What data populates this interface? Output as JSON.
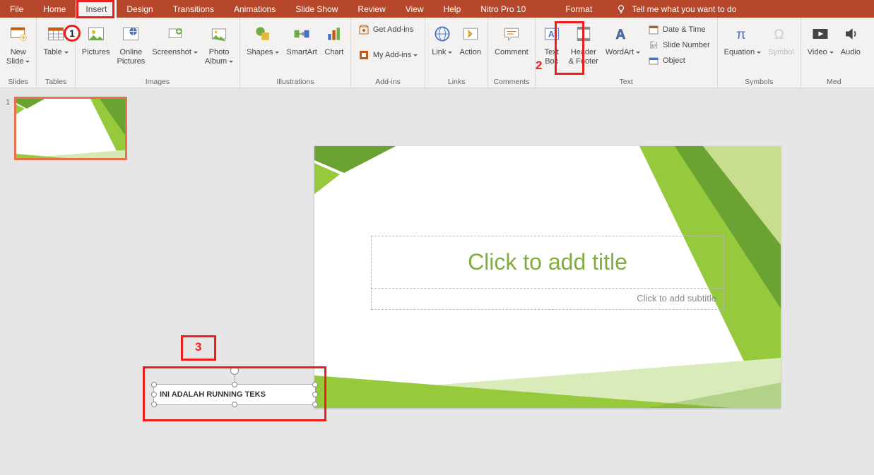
{
  "menu": {
    "tabs": [
      "File",
      "Home",
      "Insert",
      "Design",
      "Transitions",
      "Animations",
      "Slide Show",
      "Review",
      "View",
      "Help",
      "Nitro Pro 10",
      "Format"
    ],
    "active_index": 2,
    "tellme": "Tell me what you want to do"
  },
  "ribbon": {
    "groups": {
      "slides": {
        "label": "Slides",
        "new_slide": "New\nSlide"
      },
      "tables": {
        "label": "Tables",
        "table": "Table"
      },
      "images": {
        "label": "Images",
        "pictures": "Pictures",
        "online_pictures": "Online\nPictures",
        "screenshot": "Screenshot",
        "photo_album": "Photo\nAlbum"
      },
      "illustrations": {
        "label": "Illustrations",
        "shapes": "Shapes",
        "smartart": "SmartArt",
        "chart": "Chart"
      },
      "addins": {
        "label": "Add-ins",
        "get": "Get Add-ins",
        "my": "My Add-ins"
      },
      "links": {
        "label": "Links",
        "link": "Link",
        "action": "Action"
      },
      "comments": {
        "label": "Comments",
        "comment": "Comment"
      },
      "text": {
        "label": "Text",
        "text_box": "Text\nBox",
        "header_footer": "Header\n& Footer",
        "wordart": "WordArt",
        "date_time": "Date & Time",
        "slide_number": "Slide Number",
        "object": "Object"
      },
      "symbols": {
        "label": "Symbols",
        "equation": "Equation",
        "symbol": "Symbol"
      },
      "media": {
        "label": "Med",
        "video": "Video",
        "audio": "Audio"
      }
    }
  },
  "thumb": {
    "number": "1"
  },
  "slide": {
    "title_placeholder": "Click to add title",
    "subtitle_placeholder": "Click to add subtitle"
  },
  "textbox": {
    "text": "INI ADALAH RUNNING TEKS"
  },
  "annotations": {
    "n1": "1",
    "n2": "2",
    "n3": "3"
  }
}
